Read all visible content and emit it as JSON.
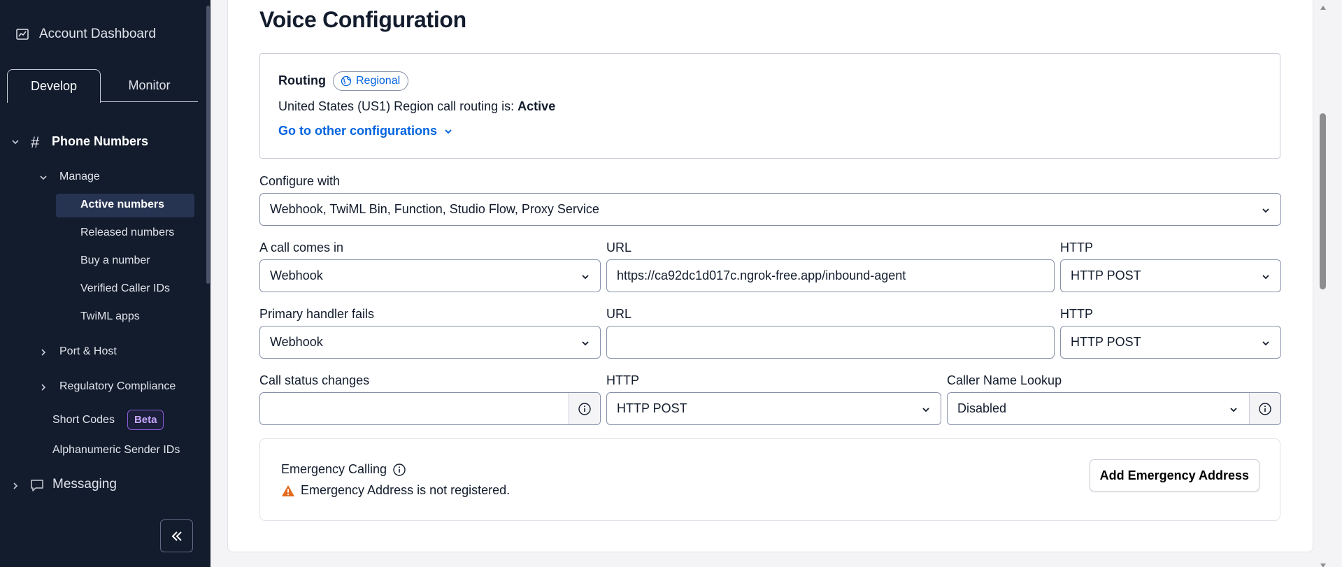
{
  "sidebar": {
    "account_dashboard": "Account Dashboard",
    "tabs": {
      "develop": "Develop",
      "monitor": "Monitor"
    },
    "phone_numbers": "Phone Numbers",
    "manage": "Manage",
    "manage_items": [
      "Active numbers",
      "Released numbers",
      "Buy a number",
      "Verified Caller IDs",
      "TwiML apps"
    ],
    "port_host": "Port & Host",
    "regulatory": "Regulatory Compliance",
    "short_codes": "Short Codes",
    "beta": "Beta",
    "alphanumeric": "Alphanumeric Sender IDs",
    "messaging": "Messaging"
  },
  "main": {
    "title": "Voice Configuration",
    "routing": {
      "label": "Routing",
      "badge": "Regional",
      "text": "United States (US1) Region call routing is: ",
      "status": "Active",
      "other_link": "Go to other configurations"
    },
    "configure_with": {
      "label": "Configure with",
      "value": "Webhook, TwiML Bin, Function, Studio Flow, Proxy Service"
    },
    "call_comes_in": {
      "label": "A call comes in",
      "value": "Webhook",
      "url_label": "URL",
      "url": "https://ca92dc1d017c.ngrok-free.app/inbound-agent",
      "http_label": "HTTP",
      "http": "HTTP POST"
    },
    "primary_fails": {
      "label": "Primary handler fails",
      "value": "Webhook",
      "url_label": "URL",
      "url": "",
      "http_label": "HTTP",
      "http": "HTTP POST"
    },
    "status_changes": {
      "label": "Call status changes",
      "value": "",
      "http_label": "HTTP",
      "http": "HTTP POST",
      "caller_label": "Caller Name Lookup",
      "caller": "Disabled"
    },
    "emergency": {
      "title": "Emergency Calling",
      "warning": "Emergency Address is not registered.",
      "button": "Add Emergency Address"
    }
  },
  "colors": {
    "sidebar_bg": "#121c2d",
    "link": "#0263e0",
    "warning": "#e56a1e",
    "beta": "#8c5bd8"
  }
}
